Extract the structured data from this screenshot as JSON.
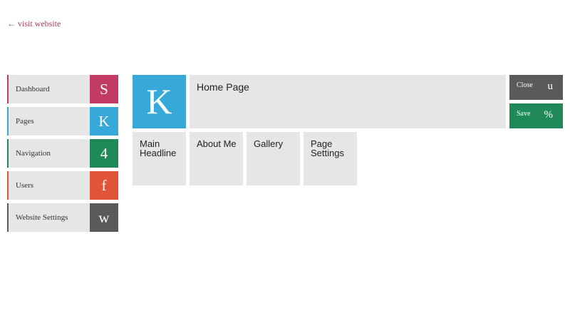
{
  "visit_link": {
    "label": "← visit website"
  },
  "sidebar": {
    "items": [
      {
        "label": "Dashboard",
        "glyph": "S",
        "color": "#c23b63"
      },
      {
        "label": "Pages",
        "glyph": "K",
        "color": "#37a9d9"
      },
      {
        "label": "Navigation",
        "glyph": "4",
        "color": "#1f8a57"
      },
      {
        "label": "Users",
        "glyph": "f",
        "color": "#e0553a"
      },
      {
        "label": "Website Settings",
        "glyph": "w",
        "color": "#5a5a5a"
      }
    ]
  },
  "header": {
    "hero_glyph": "K",
    "hero_color": "#37a9d9",
    "title": "Home Page"
  },
  "actions": {
    "close": {
      "label": "Close",
      "glyph": "u",
      "color": "#5a5a5a"
    },
    "save": {
      "label": "Save",
      "glyph": "%",
      "color": "#1f8a57"
    }
  },
  "sections": [
    {
      "label": "Main Headline"
    },
    {
      "label": "About Me"
    },
    {
      "label": "Gallery"
    },
    {
      "label": "Page Settings"
    }
  ]
}
